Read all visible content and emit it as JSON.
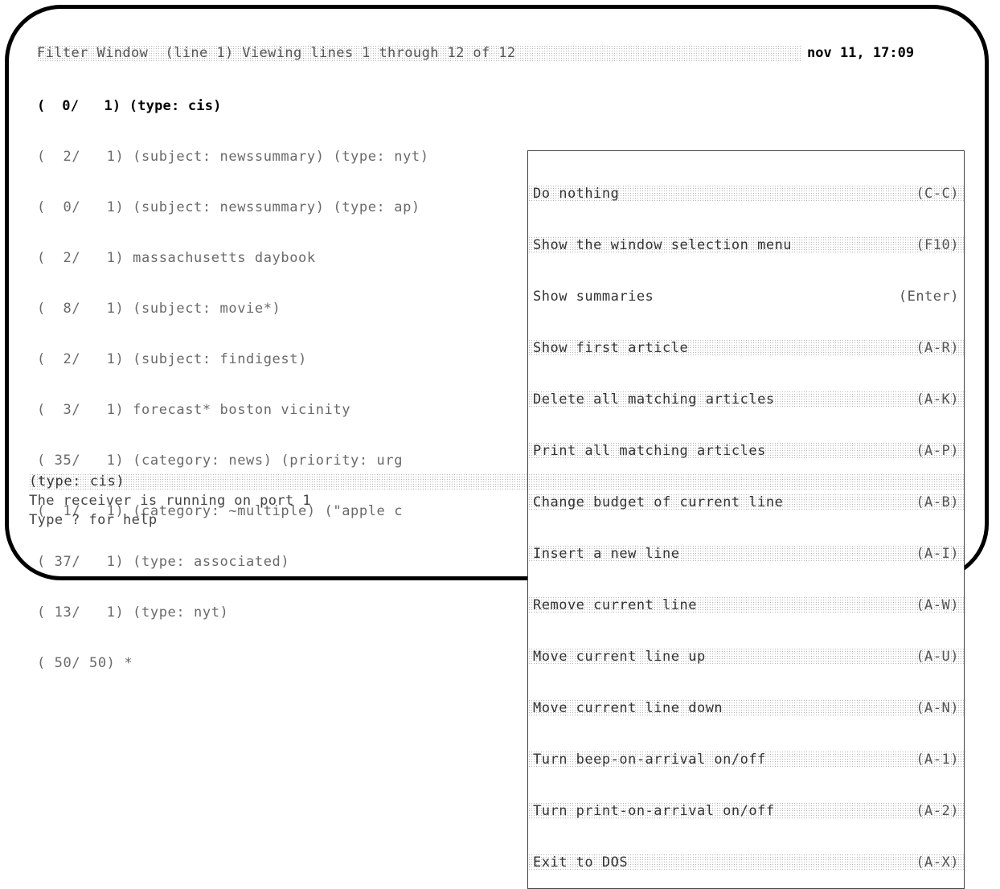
{
  "title_bar": {
    "text": "Filter Window  (line 1) Viewing lines 1 through 12 of 12",
    "clock": "nov 11, 17:09"
  },
  "rows": [
    "(  0/   1) (type: cis)",
    "(  2/   1) (subject: newssummary) (type: nyt)",
    "(  0/   1) (subject: newssummary) (type: ap)",
    "(  2/   1) massachusetts daybook",
    "(  8/   1) (subject: movie*)",
    "(  2/   1) (subject: findigest)",
    "(  3/   1) forecast* boston vicinity",
    "( 35/   1) (category: news) (priority: urg",
    "(  1/   1) (category: ~multiple) (\"apple c",
    "( 37/   1) (type: associated)",
    "( 13/   1) (type: nyt)",
    "( 50/ 50) *"
  ],
  "menu": [
    {
      "label": "Do nothing",
      "key": "(C-C)"
    },
    {
      "label": "Show the window selection menu",
      "key": "(F10)"
    },
    {
      "label": "Show summaries",
      "key": "(Enter)"
    },
    {
      "label": "Show first article",
      "key": "(A-R)"
    },
    {
      "label": "Delete all matching articles",
      "key": "(A-K)"
    },
    {
      "label": "Print all matching articles",
      "key": "(A-P)"
    },
    {
      "label": "Change budget of current line",
      "key": "(A-B)"
    },
    {
      "label": "Insert a new line",
      "key": "(A-I)"
    },
    {
      "label": "Remove current line",
      "key": "(A-W)"
    },
    {
      "label": "Move current line up",
      "key": "(A-U)"
    },
    {
      "label": "Move current line down",
      "key": "(A-N)"
    },
    {
      "label": "Turn beep-on-arrival on/off",
      "key": "(A-1)"
    },
    {
      "label": "Turn print-on-arrival on/off",
      "key": "(A-2)"
    },
    {
      "label": "Exit to DOS",
      "key": "(A-X)"
    }
  ],
  "status": {
    "text": "(type: cis)",
    "message1": "The receiver is running on port 1",
    "message2": "Type ? for help"
  }
}
